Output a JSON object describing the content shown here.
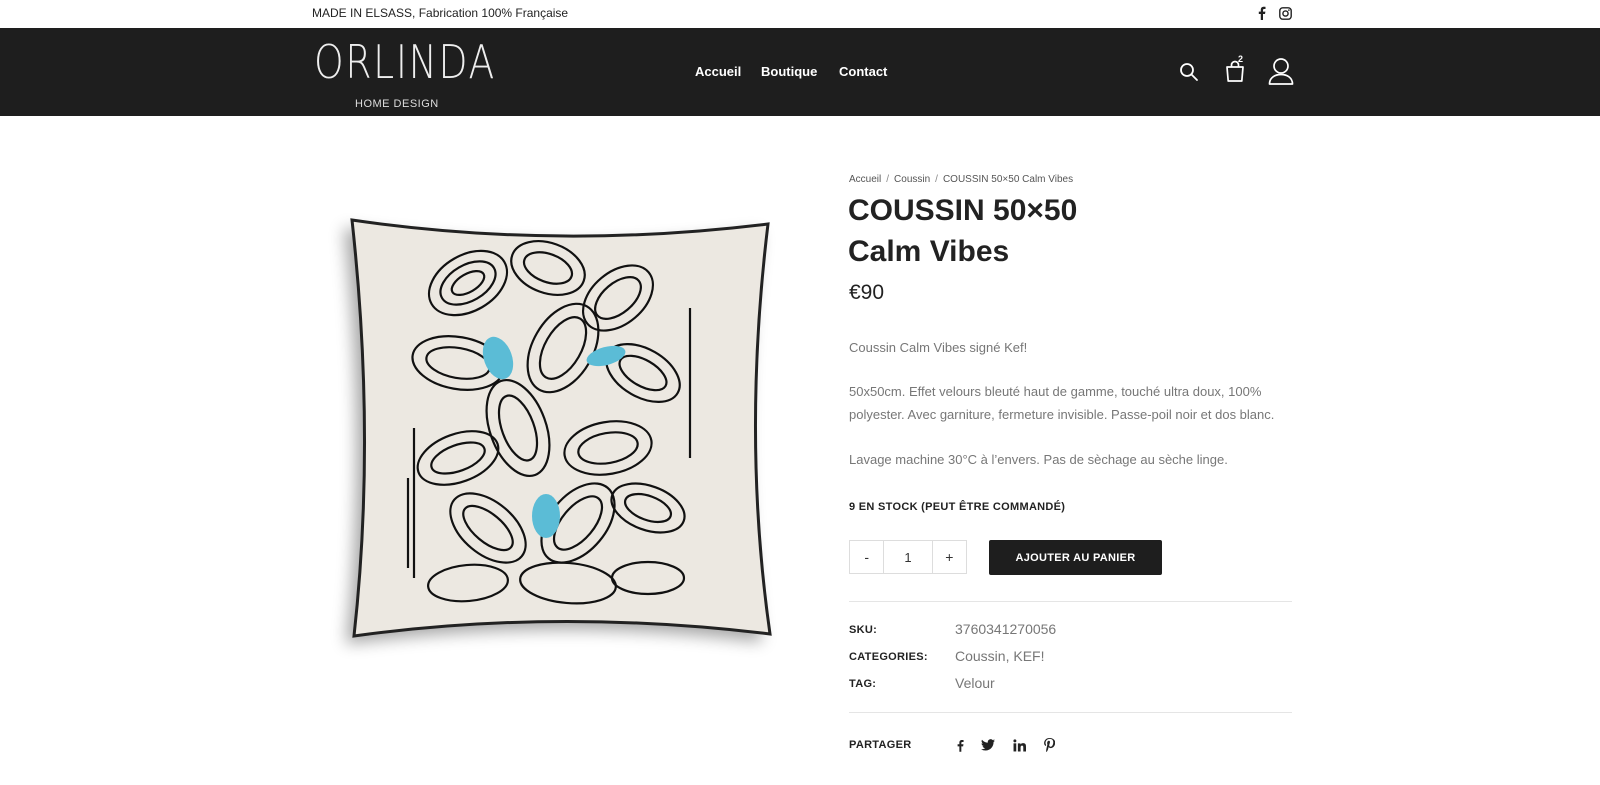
{
  "topbar": {
    "text": "MADE IN ELSASS, Fabrication 100% Française"
  },
  "header": {
    "logo_main": "ORLINDA",
    "logo_sub": "HOME DESIGN",
    "nav": [
      "Accueil",
      "Boutique",
      "Contact"
    ],
    "cart_count": "2"
  },
  "breadcrumb": [
    "Accueil",
    "Coussin",
    "COUSSIN 50×50 Calm Vibes"
  ],
  "product": {
    "title_line1": "COUSSIN 50×50",
    "title_line2": "Calm Vibes",
    "price": "€90",
    "desc1": "Coussin Calm Vibes  signé Kef!",
    "desc2": "50x50cm. Effet velours bleuté haut de gamme, touché ultra doux, 100% polyester. Avec garniture, fermeture invisible. Passe-poil noir et dos blanc.",
    "desc3": "Lavage machine 30°C à l’envers. Pas de sèchage au sèche linge.",
    "stock": "9 EN STOCK (PEUT ÊTRE COMMANDÉ)",
    "qty_minus": "-",
    "qty_value": "1",
    "qty_plus": "+",
    "add_to_cart": "AJOUTER AU PANIER"
  },
  "meta": {
    "sku_label": "SKU:",
    "sku_value": "3760341270056",
    "cat_label": "CATEGORIES:",
    "cat_value": "Coussin, KEF!",
    "tag_label": "TAG:",
    "tag_value": "Velour"
  },
  "share": {
    "label": "PARTAGER",
    "icons": [
      "facebook-icon",
      "twitter-icon",
      "linkedin-icon",
      "pinterest-icon"
    ]
  },
  "colors": {
    "header_bg": "#1e1e1e",
    "accent_blue": "#5bbcd6",
    "text_muted": "#777777"
  }
}
